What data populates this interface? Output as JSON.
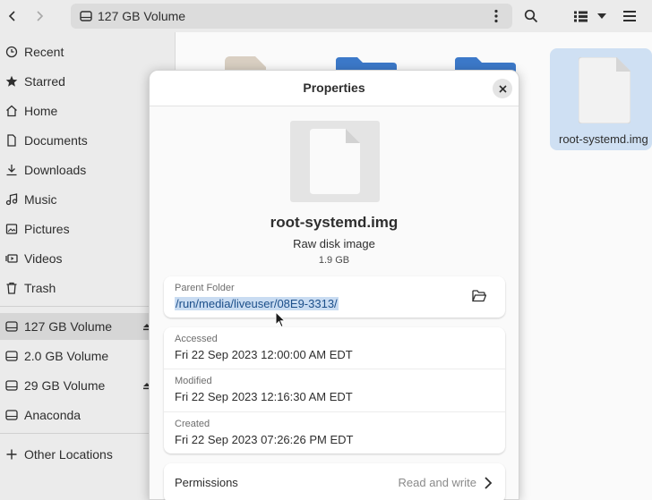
{
  "header": {
    "location": "127 GB Volume",
    "icons": [
      "back-icon",
      "forward-icon",
      "drive-icon",
      "kebab-menu-icon",
      "search-icon",
      "list-view-icon",
      "chevron-down-icon",
      "hamburger-menu-icon"
    ]
  },
  "sidebar": {
    "places": [
      {
        "label": "Recent",
        "icon": "clock-icon"
      },
      {
        "label": "Starred",
        "icon": "star-icon"
      },
      {
        "label": "Home",
        "icon": "home-icon"
      },
      {
        "label": "Documents",
        "icon": "document-icon"
      },
      {
        "label": "Downloads",
        "icon": "download-icon"
      },
      {
        "label": "Music",
        "icon": "music-icon"
      },
      {
        "label": "Pictures",
        "icon": "picture-icon"
      },
      {
        "label": "Videos",
        "icon": "video-icon"
      },
      {
        "label": "Trash",
        "icon": "trash-icon"
      }
    ],
    "volumes": [
      {
        "label": "127 GB Volume",
        "icon": "drive-icon",
        "eject": true,
        "active": true
      },
      {
        "label": "2.0 GB Volume",
        "icon": "drive-icon",
        "eject": false,
        "active": false
      },
      {
        "label": "29 GB Volume",
        "icon": "drive-icon",
        "eject": true,
        "active": false
      },
      {
        "label": "Anaconda",
        "icon": "drive-icon",
        "eject": false,
        "active": false
      }
    ],
    "other": {
      "label": "Other Locations",
      "icon": "plus-icon"
    }
  },
  "files": {
    "selected_name": "root-systemd.img"
  },
  "dialog": {
    "title": "Properties",
    "file_name": "root-systemd.img",
    "file_type": "Raw disk image",
    "file_size": "1.9 GB",
    "parent_folder": {
      "caption": "Parent Folder",
      "value": "/run/media/liveuser/08E9-3313/"
    },
    "times": [
      {
        "caption": "Accessed",
        "value": "Fri 22 Sep 2023 12:00:00 AM EDT"
      },
      {
        "caption": "Modified",
        "value": "Fri 22 Sep 2023 12:16:30 AM EDT"
      },
      {
        "caption": "Created",
        "value": "Fri 22 Sep 2023 07:26:26 PM EDT"
      }
    ],
    "permissions": {
      "label": "Permissions",
      "value": "Read and write"
    }
  },
  "colors": {
    "sidebar_bg": "#ebebeb",
    "selection": "#c9dcf2",
    "folder_blue": "#3c79c9",
    "accent_text": "#1c4f8a"
  }
}
